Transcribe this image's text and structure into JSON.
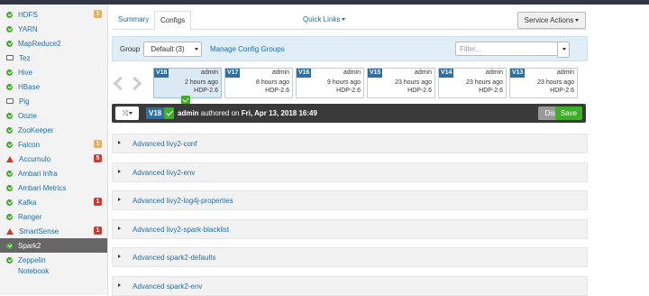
{
  "sidebar": {
    "items": [
      {
        "label": "HDFS",
        "status": "ok",
        "badge": "1",
        "badge_color": "#f0ad4e"
      },
      {
        "label": "YARN",
        "status": "ok",
        "badge": null
      },
      {
        "label": "MapReduce2",
        "status": "ok",
        "badge": null
      },
      {
        "label": "Tez",
        "status": "client",
        "badge": null
      },
      {
        "label": "Hive",
        "status": "ok",
        "badge": null
      },
      {
        "label": "HBase",
        "status": "ok",
        "badge": null
      },
      {
        "label": "Pig",
        "status": "client",
        "badge": null
      },
      {
        "label": "Oozie",
        "status": "ok",
        "badge": null
      },
      {
        "label": "ZooKeeper",
        "status": "ok",
        "badge": null
      },
      {
        "label": "Falcon",
        "status": "ok",
        "badge": "1",
        "badge_color": "#f0ad4e"
      },
      {
        "label": "Accumulo",
        "status": "alert",
        "badge": "5",
        "badge_color": "#d9352b"
      },
      {
        "label": "Ambari Infra",
        "status": "ok",
        "badge": null
      },
      {
        "label": "Ambari Metrics",
        "status": "ok",
        "badge": null
      },
      {
        "label": "Kafka",
        "status": "ok",
        "badge": "1",
        "badge_color": "#d9352b"
      },
      {
        "label": "Ranger",
        "status": "ok",
        "badge": null
      },
      {
        "label": "SmartSense",
        "status": "alert",
        "badge": "1",
        "badge_color": "#d9352b"
      },
      {
        "label": "Spark2",
        "status": "ok",
        "badge": null,
        "active": true
      },
      {
        "label": "Zeppelin",
        "label2": "Notebook",
        "status": "ok",
        "badge": null
      }
    ]
  },
  "tabs": {
    "summary": "Summary",
    "configs": "Configs"
  },
  "quick_links": "Quick Links",
  "service_actions": "Service Actions",
  "group": {
    "label": "Group",
    "selected": "Default (3)",
    "manage": "Manage Config Groups",
    "filter_placeholder": "Filter..."
  },
  "versions": [
    {
      "label": "V18",
      "user": "admin",
      "time": "2 hours ago",
      "stack": "HDP-2.6",
      "current": true
    },
    {
      "label": "V17",
      "user": "admin",
      "time": "8 hours ago",
      "stack": "HDP-2.6"
    },
    {
      "label": "V16",
      "user": "admin",
      "time": "9 hours ago",
      "stack": "HDP-2.6"
    },
    {
      "label": "V15",
      "user": "admin",
      "time": "23 hours ago",
      "stack": "HDP-2.6"
    },
    {
      "label": "V14",
      "user": "admin",
      "time": "23 hours ago",
      "stack": "HDP-2.6"
    },
    {
      "label": "V13",
      "user": "admin",
      "time": "23 hours ago",
      "stack": "HDP-2.6"
    }
  ],
  "current_bar": {
    "version": "V18",
    "author": "admin",
    "authored_text": "authored on",
    "date": "Fri, Apr 13, 2018 16:49",
    "discard": "Discard",
    "save": "Save"
  },
  "sections": [
    "Advanced livy2-conf",
    "Advanced livy2-env",
    "Advanced livy2-log4j-properties",
    "Advanced livy2-spark-blacklist",
    "Advanced spark2-defaults",
    "Advanced spark2-env"
  ],
  "colors": {
    "accent": "#1c6fb3",
    "ok": "#3fae2a",
    "alert": "#d9352b",
    "version": "#2e6fa0"
  }
}
